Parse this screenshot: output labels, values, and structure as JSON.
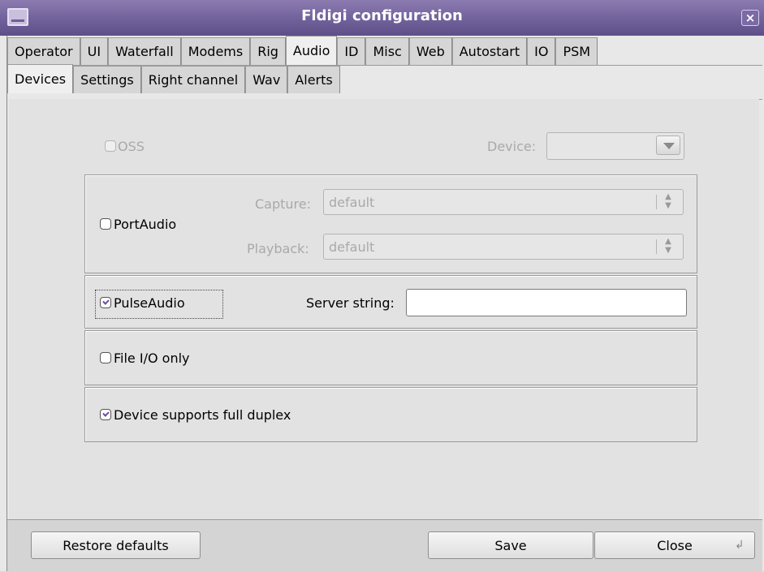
{
  "window": {
    "title": "Fldigi configuration",
    "app_icon": "window-icon",
    "close_label": "×"
  },
  "tabs_main": [
    {
      "label": "Operator"
    },
    {
      "label": "UI"
    },
    {
      "label": "Waterfall"
    },
    {
      "label": "Modems"
    },
    {
      "label": "Rig"
    },
    {
      "label": "Audio",
      "active": true
    },
    {
      "label": "ID"
    },
    {
      "label": "Misc"
    },
    {
      "label": "Web"
    },
    {
      "label": "Autostart"
    },
    {
      "label": "IO"
    },
    {
      "label": "PSM"
    }
  ],
  "tabs_sub": [
    {
      "label": "Devices",
      "active": true
    },
    {
      "label": "Settings"
    },
    {
      "label": "Right channel"
    },
    {
      "label": "Wav"
    },
    {
      "label": "Alerts"
    }
  ],
  "oss": {
    "label": "OSS",
    "checked": false,
    "enabled": false,
    "device_label": "Device:",
    "device_value": ""
  },
  "portaudio": {
    "label": "PortAudio",
    "checked": false,
    "capture_label": "Capture:",
    "capture_value": "default",
    "playback_label": "Playback:",
    "playback_value": "default"
  },
  "pulseaudio": {
    "label": "PulseAudio",
    "checked": true,
    "server_label": "Server string:",
    "server_value": ""
  },
  "fileio": {
    "label": "File I/O only",
    "checked": false
  },
  "duplex": {
    "label": "Device supports full duplex",
    "checked": true
  },
  "buttons": {
    "restore": "Restore defaults",
    "save": "Save",
    "close": "Close"
  },
  "colors": {
    "titlebar": "#6f5f99",
    "check_accent": "#6d4b9e"
  }
}
